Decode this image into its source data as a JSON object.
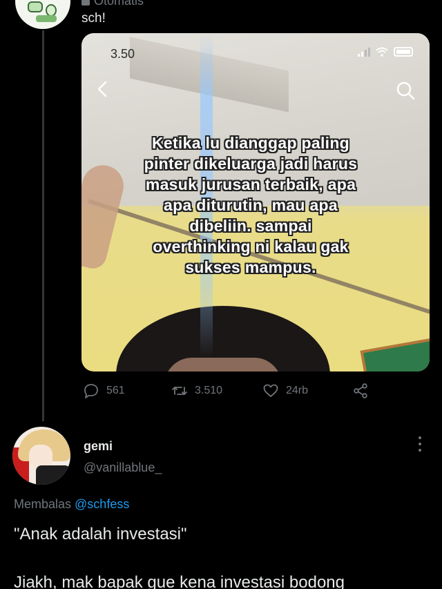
{
  "quoted_tweet": {
    "name_fragment": "Otomatis",
    "text": "sch!"
  },
  "media": {
    "status_time": "3.50",
    "overlay_text": "Ketika lu dianggap paling\npinter dikeluarga jadi harus\nmasuk jurusan terbaik, apa\napa diturutin, mau apa\ndibeliin. sampai\noverthinking ni kalau gak\nsukses mampus."
  },
  "actions": {
    "replies": "561",
    "retweets": "3.510",
    "likes": "24rb"
  },
  "reply": {
    "display_name": "gemi",
    "handle": "@vanillablue_",
    "replying_prefix": "Membalas ",
    "replying_to": "@schfess",
    "line1": "\"Anak adalah investasi\"",
    "line2": "Jiakh, mak bapak gue kena investasi bodong"
  },
  "colors": {
    "background": "#000000",
    "text": "#e7e9ea",
    "muted": "#71767b",
    "link": "#1d9bf0"
  },
  "icons": [
    "reply-icon",
    "retweet-icon",
    "like-icon",
    "share-icon",
    "more-icon",
    "back-icon",
    "search-icon"
  ]
}
